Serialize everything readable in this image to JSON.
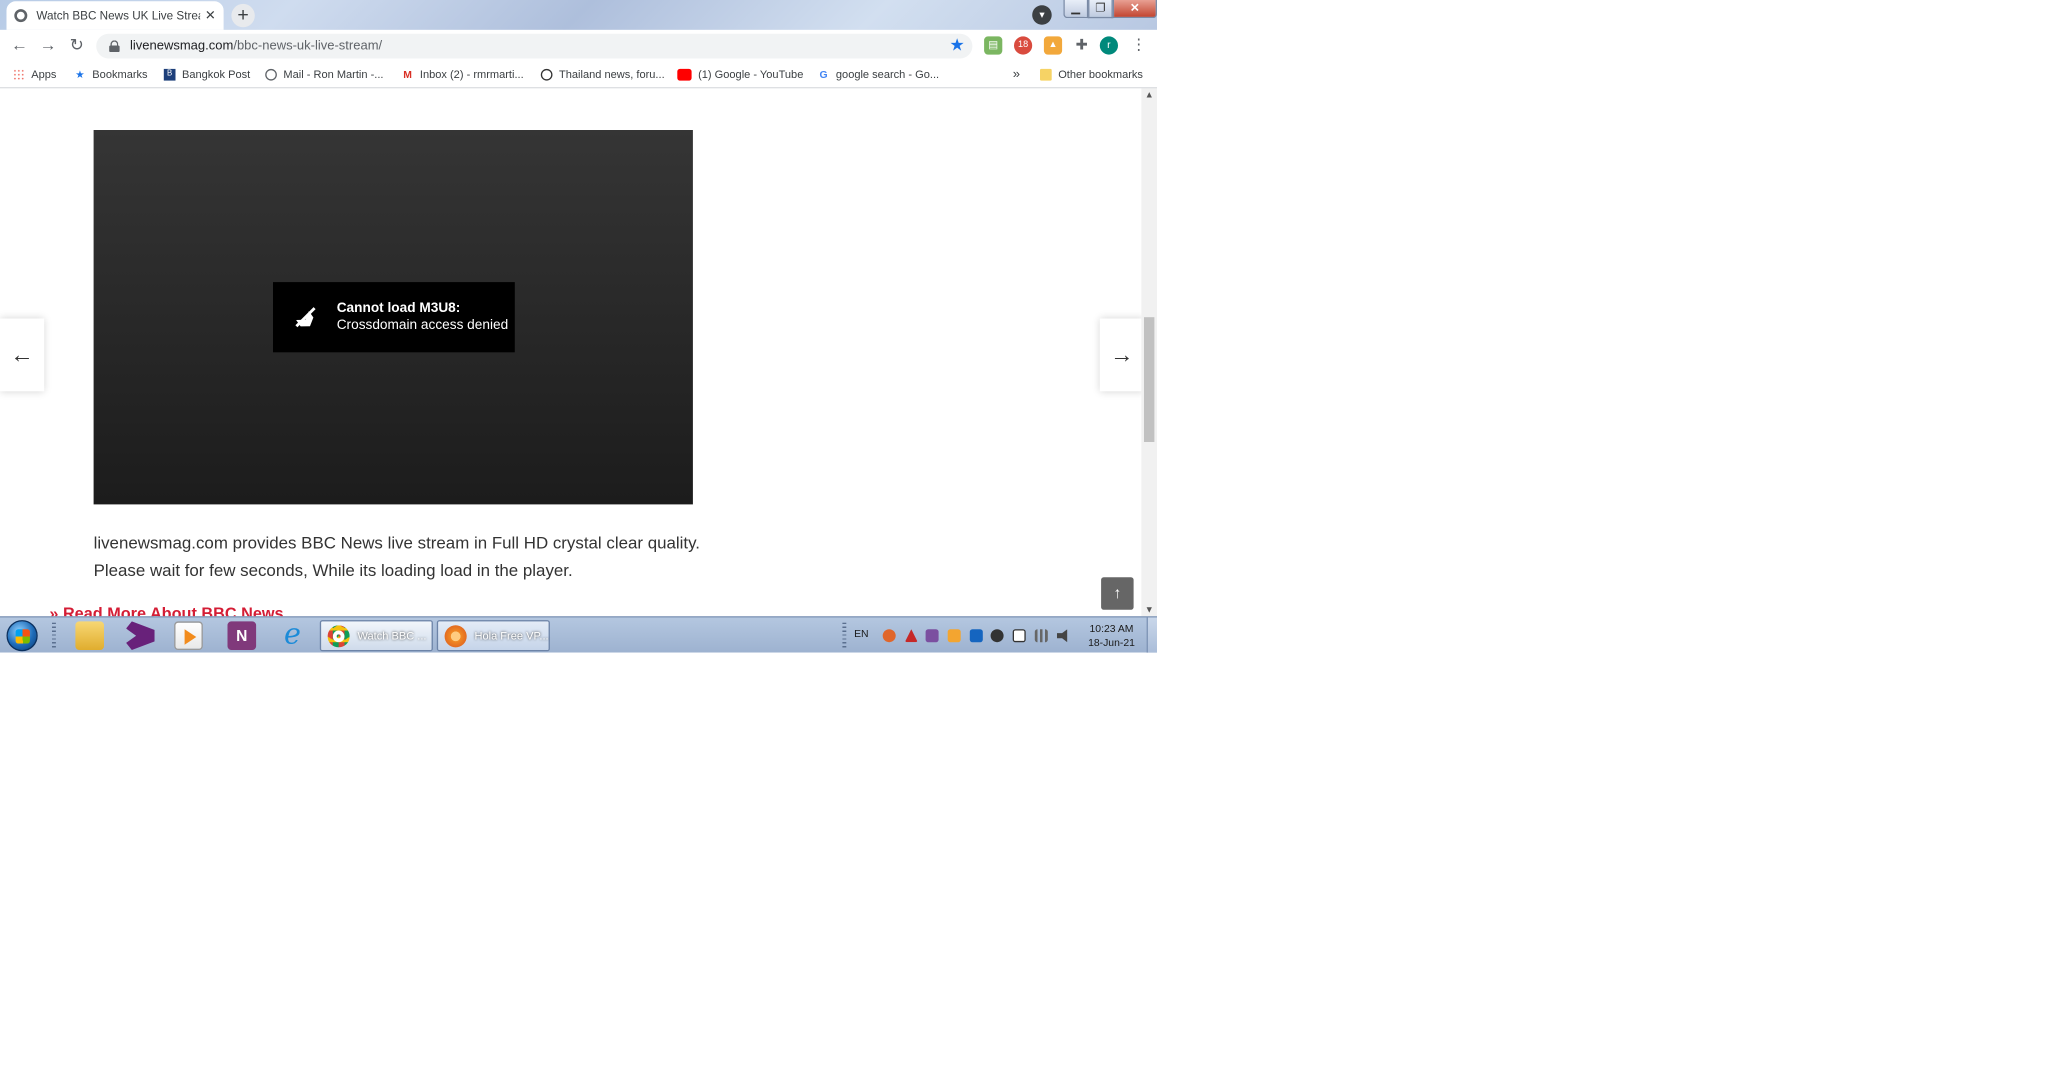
{
  "browser": {
    "tab_title": "Watch BBC News UK Live Stream",
    "tab_close": "✕",
    "new_tab": "+",
    "window_controls": {
      "minimize": "▁",
      "maximize": "❐",
      "close": "✕"
    },
    "url_host": "livenewsmag.com",
    "url_path": "/bbc-news-uk-live-stream/",
    "bookmarks": [
      {
        "label": "Apps",
        "icon": "apps-grid-icon"
      },
      {
        "label": "Bookmarks",
        "icon": "star-icon"
      },
      {
        "label": "Bangkok Post",
        "icon": "bangkok-post-icon"
      },
      {
        "label": "Mail - Ron Martin -...",
        "icon": "globe-icon"
      },
      {
        "label": "Inbox (2) - rmrmarti...",
        "icon": "gmail-icon"
      },
      {
        "label": "Thailand news, foru...",
        "icon": "thaivisa-icon"
      },
      {
        "label": "(1) Google - YouTube",
        "icon": "youtube-icon"
      },
      {
        "label": "google search - Go...",
        "icon": "google-icon"
      }
    ],
    "bookmarks_more": "»",
    "other_bookmarks": "Other bookmarks",
    "profile_initial": "r",
    "ext_badge": "18"
  },
  "page": {
    "player_error_title": "Cannot load M3U8:",
    "player_error_detail": "Crossdomain access denied",
    "description": "livenewsmag.com provides BBC News live stream in Full HD crystal clear quality. Please wait for few seconds, While its loading load in the player.",
    "read_more": "» Read More About BBC News",
    "prev_arrow": "←",
    "next_arrow": "→",
    "back_to_top": "↑"
  },
  "taskbar": {
    "tasks": [
      {
        "label": "Watch BBC ...",
        "app": "chrome"
      },
      {
        "label": "Hola Free VP...",
        "app": "hola"
      }
    ],
    "language": "EN",
    "time": "10:23 AM",
    "date": "18-Jun-21"
  }
}
